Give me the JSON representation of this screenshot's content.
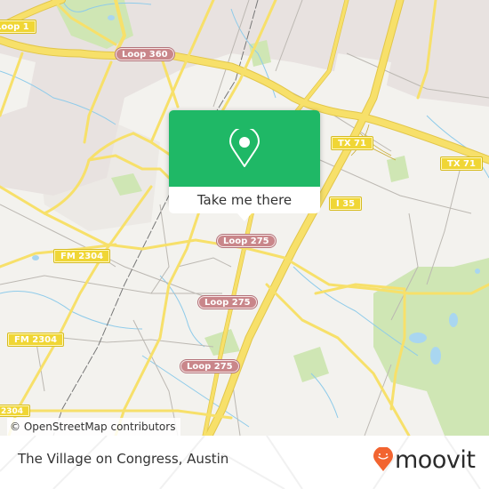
{
  "map": {
    "attribution": "© OpenStreetMap contributors",
    "road_labels": [
      {
        "id": "loop-1",
        "text": "Loop 1",
        "kind": "yellow"
      },
      {
        "id": "loop-360",
        "text": "Loop 360",
        "kind": "loop"
      },
      {
        "id": "tx-71-west",
        "text": "TX 71",
        "kind": "yellow"
      },
      {
        "id": "tx-71-east",
        "text": "TX 71",
        "kind": "yellow"
      },
      {
        "id": "i-35",
        "text": "I 35",
        "kind": "yellow"
      },
      {
        "id": "loop-275-north",
        "text": "Loop 275",
        "kind": "loop"
      },
      {
        "id": "fm-2304-north",
        "text": "FM 2304",
        "kind": "yellow"
      },
      {
        "id": "loop-275-mid",
        "text": "Loop 275",
        "kind": "loop"
      },
      {
        "id": "fm-2304-south",
        "text": "FM 2304",
        "kind": "yellow"
      },
      {
        "id": "loop-275-south",
        "text": "Loop 275",
        "kind": "loop"
      },
      {
        "id": "fm-2304-edge",
        "text": "2304",
        "kind": "yellow"
      }
    ],
    "colors": {
      "background": "#f3f2ee",
      "major_road": "#f7e06a",
      "minor_road": "#b9b6b0",
      "water": "#8ecbea",
      "park": "#cfe6b4",
      "urban": "#e7e1df"
    }
  },
  "popup": {
    "icon": "location-pin-icon",
    "button_label": "Take me there",
    "color": "#1fb866"
  },
  "footer": {
    "place_name": "The Village on Congress, Austin",
    "logo_text": "moovit",
    "logo_color": "#f26430"
  }
}
